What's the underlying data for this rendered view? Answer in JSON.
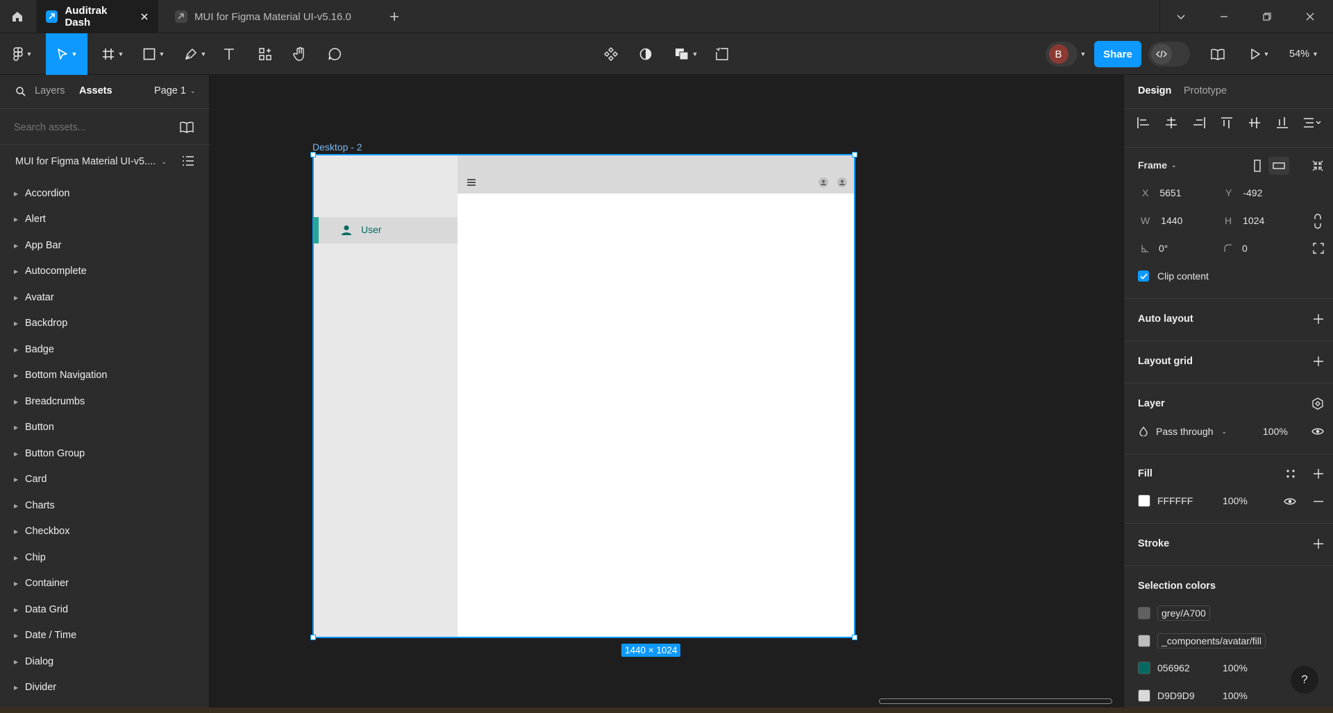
{
  "titlebar": {
    "tabs": [
      {
        "label": "Auditrak Dash",
        "active": true
      },
      {
        "label": "MUI for Figma Material UI-v5.16.0",
        "active": false
      }
    ]
  },
  "toolbar": {
    "avatar_initial": "B",
    "share_label": "Share",
    "zoom": "54%"
  },
  "left_panel": {
    "tab_layers": "Layers",
    "tab_assets": "Assets",
    "page": "Page 1",
    "search_placeholder": "Search assets...",
    "library_name": "MUI for Figma Material UI-v5....",
    "items": [
      "Accordion",
      "Alert",
      "App Bar",
      "Autocomplete",
      "Avatar",
      "Backdrop",
      "Badge",
      "Bottom Navigation",
      "Breadcrumbs",
      "Button",
      "Button Group",
      "Card",
      "Charts",
      "Checkbox",
      "Chip",
      "Container",
      "Data Grid",
      "Date / Time",
      "Dialog",
      "Divider"
    ]
  },
  "canvas": {
    "frame_label": "Desktop - 2",
    "size_badge": "1440 × 1024",
    "nav_item": "User"
  },
  "right_panel": {
    "tab_design": "Design",
    "tab_prototype": "Prototype",
    "frame_title": "Frame",
    "x_label": "X",
    "x_value": "5651",
    "y_label": "Y",
    "y_value": "-492",
    "w_label": "W",
    "w_value": "1440",
    "h_label": "H",
    "h_value": "1024",
    "rotation": "0°",
    "radius": "0",
    "clip_content": "Clip content",
    "auto_layout": "Auto layout",
    "layout_grid": "Layout grid",
    "layer_title": "Layer",
    "blend_mode": "Pass through",
    "layer_opacity": "100%",
    "fill_title": "Fill",
    "fill_hex": "FFFFFF",
    "fill_opacity": "100%",
    "stroke_title": "Stroke",
    "selection_colors_title": "Selection colors",
    "selection_colors": [
      {
        "name": "grey/A700",
        "color": "#616161",
        "opacity": ""
      },
      {
        "name": "_components/avatar/fill",
        "color": "#bdbdbd",
        "opacity": ""
      },
      {
        "name": "056962",
        "color": "#056962",
        "opacity": "100%"
      },
      {
        "name": "D9D9D9",
        "color": "#d9d9d9",
        "opacity": "100%"
      }
    ]
  },
  "colors": {
    "accent": "#0d99ff",
    "share": "#0d99ff",
    "nav_teal": "#056962",
    "nav_bar": "#26a69a"
  }
}
